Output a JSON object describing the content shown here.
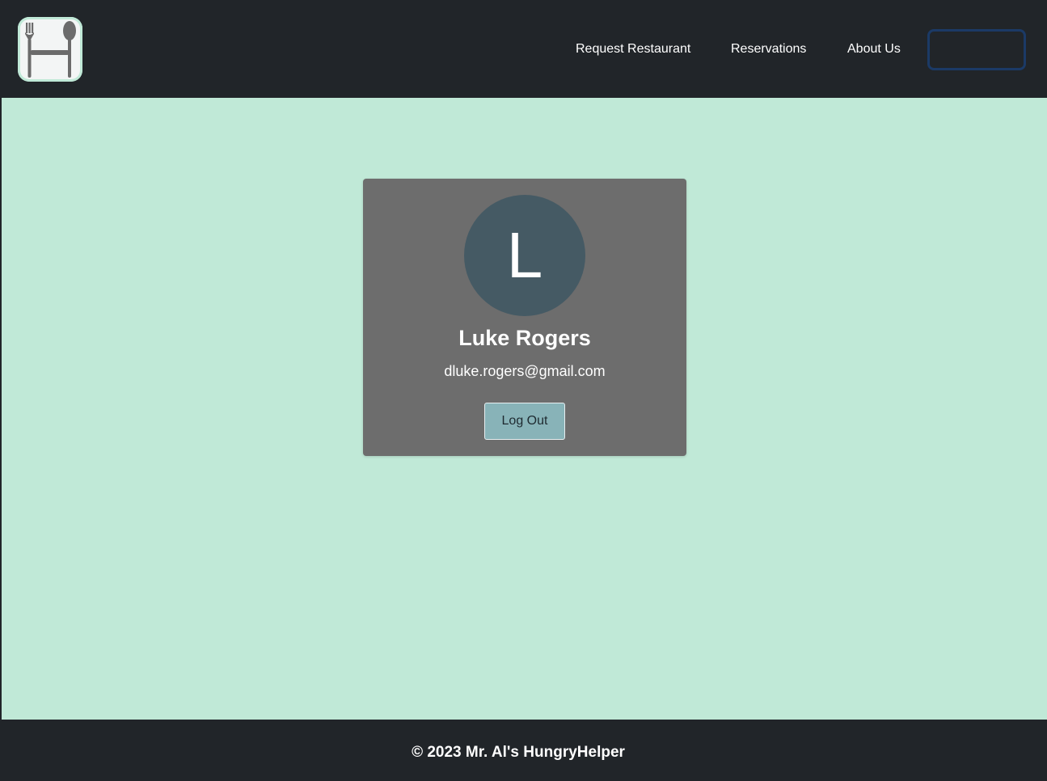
{
  "nav": {
    "logo_icon": "fork-spoon-icon",
    "links": [
      {
        "label": "Request Restaurant"
      },
      {
        "label": "Reservations"
      },
      {
        "label": "About Us"
      }
    ],
    "outline_button_label": ""
  },
  "profile": {
    "avatar_initial": "L",
    "name": "Luke Rogers",
    "email": "dluke.rogers@gmail.com",
    "logout_label": "Log Out"
  },
  "footer": {
    "text": "© 2023 Mr. Al's HungryHelper"
  },
  "colors": {
    "page_background": "#c0e9d7",
    "navbar_background": "#212529",
    "card_background": "#6d6d6d",
    "avatar_background": "#455a64",
    "logout_button": "#88b3b8",
    "outline_button_border": "#1b3a66"
  }
}
